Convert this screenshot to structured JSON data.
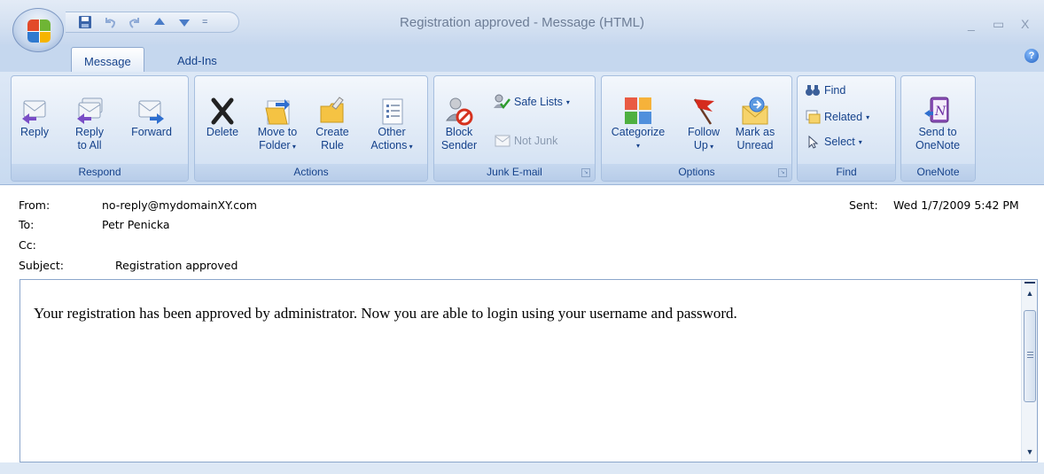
{
  "window": {
    "title": "Registration approved - Message (HTML)",
    "minimize": "_",
    "maximize": "▭",
    "close": "X"
  },
  "qat": {
    "customize": "="
  },
  "tabs": [
    {
      "label": "Message",
      "active": true
    },
    {
      "label": "Add-Ins",
      "active": false
    }
  ],
  "help": "?",
  "ribbon": {
    "respond": {
      "label": "Respond",
      "reply": "Reply",
      "reply_all_1": "Reply",
      "reply_all_2": "to All",
      "forward": "Forward"
    },
    "actions": {
      "label": "Actions",
      "delete": "Delete",
      "move_1": "Move to",
      "move_2": "Folder",
      "create_1": "Create",
      "create_2": "Rule",
      "other_1": "Other",
      "other_2": "Actions"
    },
    "junk": {
      "label": "Junk E-mail",
      "block_1": "Block",
      "block_2": "Sender",
      "safe_lists": "Safe Lists",
      "not_junk": "Not Junk"
    },
    "options": {
      "label": "Options",
      "categorize": "Categorize",
      "follow_1": "Follow",
      "follow_2": "Up",
      "mark_1": "Mark as",
      "mark_2": "Unread"
    },
    "find": {
      "label": "Find",
      "find": "Find",
      "related": "Related",
      "select": "Select"
    },
    "onenote": {
      "label": "OneNote",
      "send_1": "Send to",
      "send_2": "OneNote"
    }
  },
  "message": {
    "from_label": "From:",
    "from": "no-reply@mydomainXY.com",
    "to_label": "To:",
    "to": "Petr Penicka",
    "cc_label": "Cc:",
    "cc": "",
    "subject_label": "Subject:",
    "subject": "Registration approved",
    "sent_label": "Sent:",
    "sent": "Wed 1/7/2009 5:42 PM",
    "body": "Your registration has been approved by administrator. Now you are able to login using your username and password."
  },
  "colors": {
    "ribbon_text": "#15428b",
    "ribbon_bg": "#c8daf0",
    "office_red": "#e24a2a",
    "office_green": "#6fb535",
    "office_blue": "#2e79cf",
    "office_yellow": "#f5b400"
  }
}
